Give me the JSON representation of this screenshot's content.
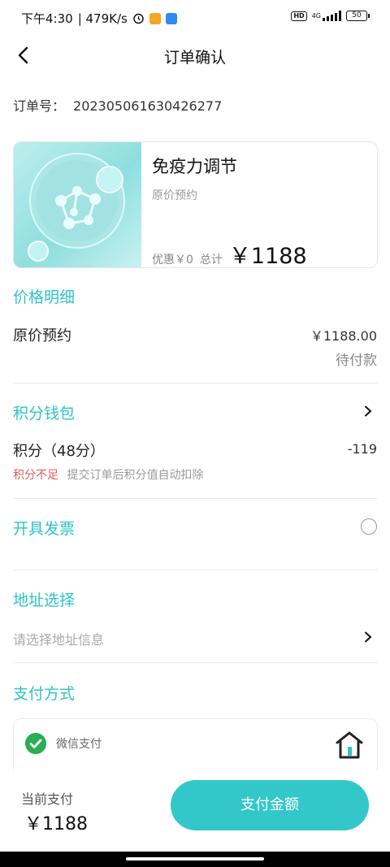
{
  "status_bar": {
    "time": "下午4:30",
    "speed": "| 479K/s",
    "network": "4G",
    "battery": "50"
  },
  "header": {
    "title": "订单确认",
    "back_icon": "chevron-left-icon"
  },
  "order": {
    "label": "订单号：",
    "number": "20230506163042627 7"
  },
  "product": {
    "name": "免疫力调节",
    "subtitle": "原价预约",
    "discount": "优惠￥0",
    "total_label": "总计",
    "total": "￥1188"
  },
  "price_detail": {
    "title": "价格明细",
    "item_label": "原价预约",
    "item_value": "￥1188.00",
    "status": "待付款"
  },
  "points": {
    "title": "积分钱包",
    "label": "积分（48分）",
    "value": "-119",
    "warning": "积分不足",
    "note": "提交订单后积分值自动扣除"
  },
  "invoice": {
    "title": "开具发票"
  },
  "address": {
    "title": "地址选择",
    "placeholder": "请选择地址信息"
  },
  "payment": {
    "title": "支付方式",
    "method": "微信支付",
    "method_icon": "wechat-pay-icon"
  },
  "bottom_bar": {
    "current_label": "当前支付",
    "current_amount": "￥1188",
    "pay_button": "支付金额"
  },
  "colors": {
    "accent": "#2ec4c6",
    "button": "#34c7c9",
    "warning": "#e05a5a"
  }
}
